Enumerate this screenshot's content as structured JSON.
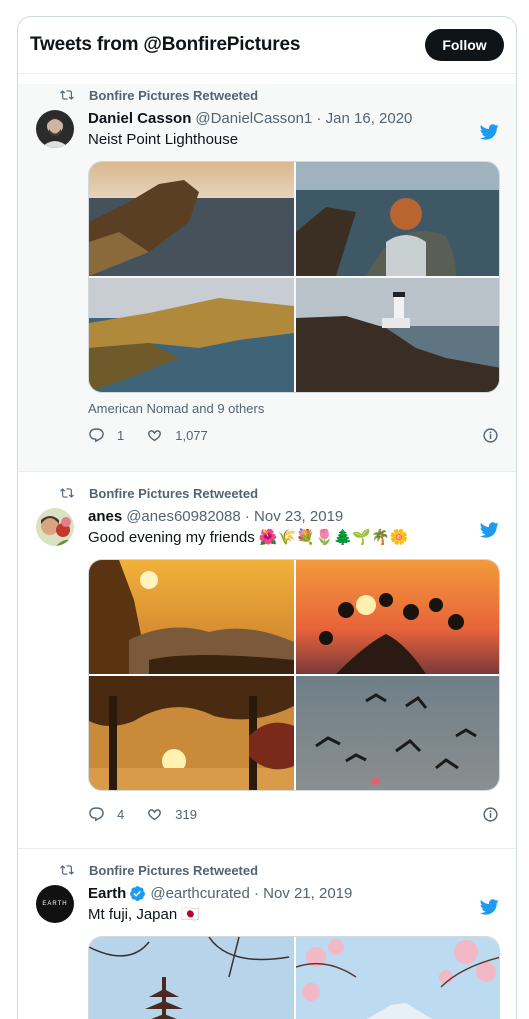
{
  "header": {
    "title": "Tweets from @BonfirePictures",
    "follow_label": "Follow"
  },
  "tweets": [
    {
      "retweet_label": "Bonfire Pictures Retweeted",
      "name": "Daniel Casson",
      "handle": "@DanielCasson1 · Jan 16, 2020",
      "text": "Neist Point Lighthouse",
      "liked_by": "American Nomad and 9 others",
      "replies": "1",
      "likes": "1,077"
    },
    {
      "retweet_label": "Bonfire Pictures Retweeted",
      "name": "anes",
      "handle": "@anes60982088 · Nov 23, 2019",
      "text": "Good evening my friends 🌺🌾💐🌷🌲🌱🌴🌼",
      "replies": "4",
      "likes": "319"
    },
    {
      "retweet_label": "Bonfire Pictures Retweeted",
      "name": "Earth",
      "handle": "@earthcurated · Nov 21, 2019",
      "text": "Mt fuji, Japan 🇯🇵",
      "avatar_label": "EARTH"
    }
  ],
  "colors": {
    "accent": "#1d9bf0",
    "text_secondary": "#536471",
    "highlight_bg": "#f7f9f9"
  },
  "icons": [
    "retweet-icon",
    "twitter-bird-icon",
    "reply-icon",
    "heart-icon",
    "info-icon",
    "verified-badge-icon"
  ]
}
